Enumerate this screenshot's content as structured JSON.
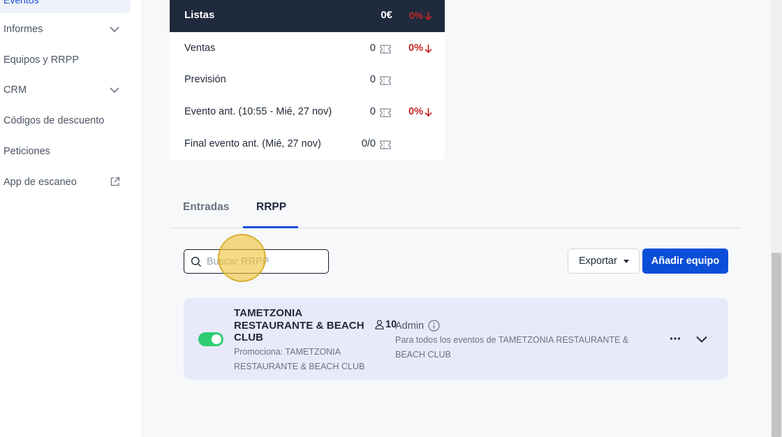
{
  "sidebar": {
    "active_label": "Eventos",
    "items": [
      {
        "label": "Informes",
        "icon": "chevron-down-icon"
      },
      {
        "label": "Equipos y RRPP"
      },
      {
        "label": "CRM",
        "icon": "chevron-down-icon"
      },
      {
        "label": "Códigos de descuento"
      },
      {
        "label": "Peticiones"
      },
      {
        "label": "App de escaneo",
        "icon": "external-link-icon"
      }
    ]
  },
  "stats": {
    "header": {
      "label": "Listas",
      "value": "0€",
      "pct": "0%"
    },
    "rows": [
      {
        "label": "Ventas",
        "num": "0",
        "pct": "0%"
      },
      {
        "label": "Previsión",
        "num": "0",
        "pct": ""
      },
      {
        "label": "Evento ant. (10:55 - Mié, 27 nov)",
        "num": "0",
        "pct": "0%"
      },
      {
        "label": "Final evento ant. (Mié, 27 nov)",
        "num": "0/0",
        "pct": ""
      }
    ],
    "down_color": "#c62828"
  },
  "tabs": {
    "entradas": "Entradas",
    "rrpp": "RRPP",
    "active": "RRPP"
  },
  "search": {
    "placeholder": "Buscar RRPP",
    "value": ""
  },
  "actions": {
    "export_label": "Exportar",
    "add_label": "Añadir equipo",
    "accent": "#0b4fd9"
  },
  "team": {
    "enabled": true,
    "name": "TAMETZONIA RESTAURANTE & BEACH CLUB",
    "promo": "Promociona: TAMETZONIA RESTAURANTE & BEACH CLUB",
    "members": "10",
    "role": "Admin",
    "role_desc": "Para todos los eventos de TAMETZONIA RESTAURANTE & BEACH CLUB"
  }
}
